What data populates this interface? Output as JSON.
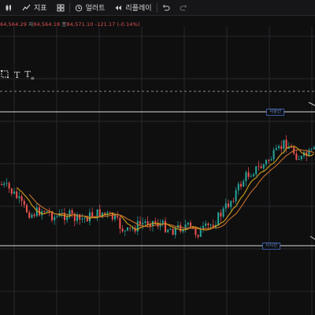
{
  "toolbar": {
    "items": [
      {
        "icon": "indicator-icon",
        "label": "지표"
      },
      {
        "icon": "layout-grid-icon",
        "label": ""
      },
      {
        "icon": "alert-clock-icon",
        "label": "얼러트"
      },
      {
        "icon": "replay-icon",
        "label": "리플레이"
      },
      {
        "icon": "undo-icon",
        "label": ""
      },
      {
        "icon": "redo-icon",
        "label": ""
      }
    ]
  },
  "ohlc": {
    "high_value": "64,564.29",
    "low_label": "저",
    "low_value": "84,564.18",
    "close_label": "종",
    "close_value": "84,571.10",
    "change": "-121.17 (-0.14%)"
  },
  "chart": {
    "resistance_label": "저항선",
    "support_label": "지지선",
    "colors": {
      "up": "#26a69a",
      "down": "#ef5350",
      "ma_fast": "#d4a016",
      "ma_slow": "#c8702a",
      "grid": "#2a2a2e",
      "hline": "#d9d9d9"
    }
  }
}
